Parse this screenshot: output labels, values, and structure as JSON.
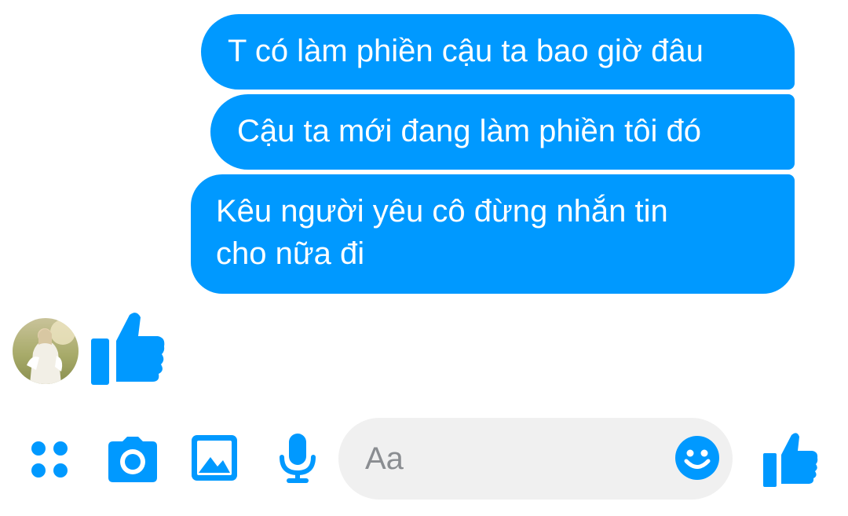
{
  "messages": [
    {
      "text": "T có làm phiền cậu ta bao giờ đâu",
      "sender": "me"
    },
    {
      "text": "Cậu ta mới đang làm phiền tôi đó",
      "sender": "me"
    },
    {
      "lines": [
        "Kêu người yêu cô đừng nhắn tin",
        "cho nữa đi"
      ],
      "sender": "me"
    }
  ],
  "received_reaction": {
    "icon": "thumbs-up-icon"
  },
  "composer": {
    "placeholder": "Aa",
    "value": "",
    "icons": [
      "apps-icon",
      "camera-icon",
      "gallery-icon",
      "microphone-icon",
      "emoji-icon",
      "thumbs-up-icon"
    ]
  },
  "colors": {
    "accent": "#0099ff",
    "bubble_text": "#ffffff",
    "input_background": "#f0f0f0",
    "placeholder": "#8a8d91"
  }
}
